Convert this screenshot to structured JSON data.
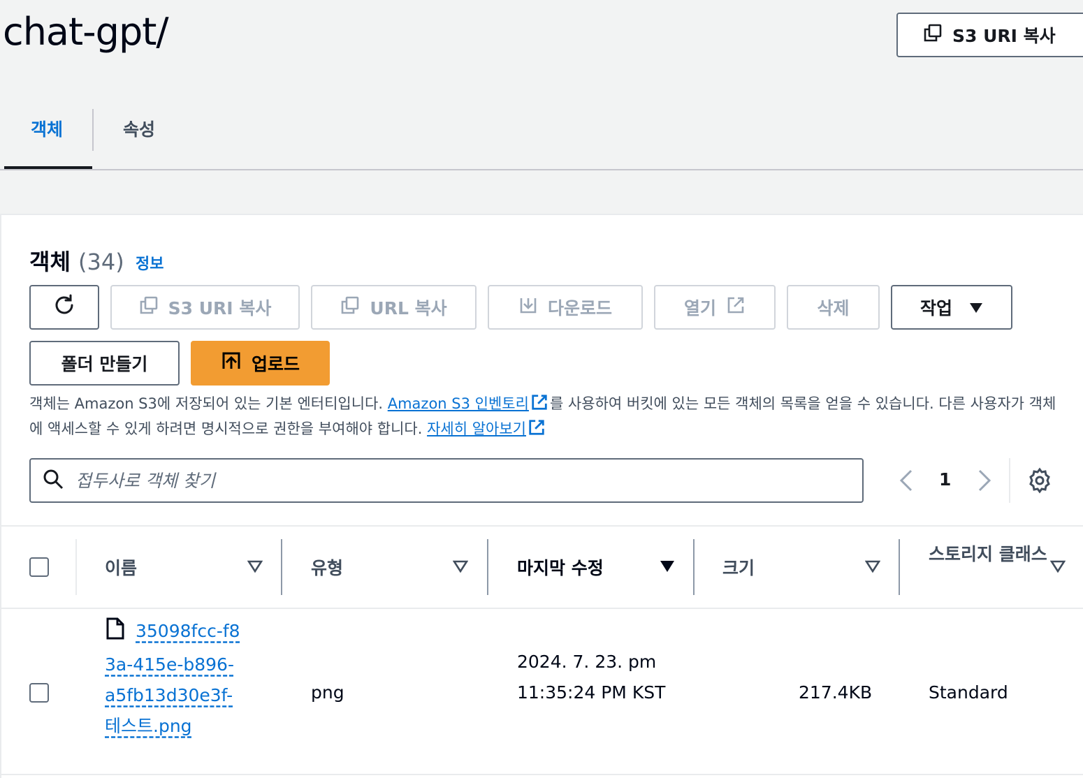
{
  "page": {
    "title": "chat-gpt/"
  },
  "header": {
    "copy_s3_uri": "S3 URI 복사"
  },
  "tabs": [
    {
      "label": "객체",
      "active": true
    },
    {
      "label": "속성",
      "active": false
    }
  ],
  "objects": {
    "heading": "객체",
    "count": "(34)",
    "info": "정보",
    "actions": {
      "refresh_icon": "refresh-icon",
      "copy_s3_uri": "S3 URI 복사",
      "copy_url": "URL 복사",
      "download": "다운로드",
      "open": "열기",
      "delete": "삭제",
      "actions": "작업",
      "create_folder": "폴더 만들기",
      "upload": "업로드"
    },
    "description": {
      "part1": "객체는 Amazon S3에 저장되어 있는 기본 엔터티입니다. ",
      "inventory_link": "Amazon S3 인벤토리",
      "part2": "를 사용하여 버킷에 있는 모든 객체의 목록을 얻을 수 있습니다. 다른 사용자가 객체에 액세스할 수 있게 하려면 명시적으로 권한을 부여해야 합니다. ",
      "learn_more": "자세히 알아보기"
    },
    "search": {
      "placeholder": "접두사로 객체 찾기",
      "value": ""
    },
    "pagination": {
      "current_page": "1"
    },
    "table": {
      "columns": [
        "이름",
        "유형",
        "마지막 수정",
        "크기",
        "스토리지 클래스"
      ],
      "sorted_column": "마지막 수정",
      "rows": [
        {
          "name": "35098fcc-f83a-415e-b896-a5fb13d30e3f-테스트.png",
          "type": "png",
          "last_modified": "2024. 7. 23. pm 11:35:24 PM KST",
          "size": "217.4KB",
          "storage_class": "Standard"
        }
      ]
    }
  },
  "colors": {
    "accent": "#0972d3",
    "primary_button": "#f29c32",
    "border": "#5f6b7a",
    "disabled": "#9ba7b6"
  }
}
